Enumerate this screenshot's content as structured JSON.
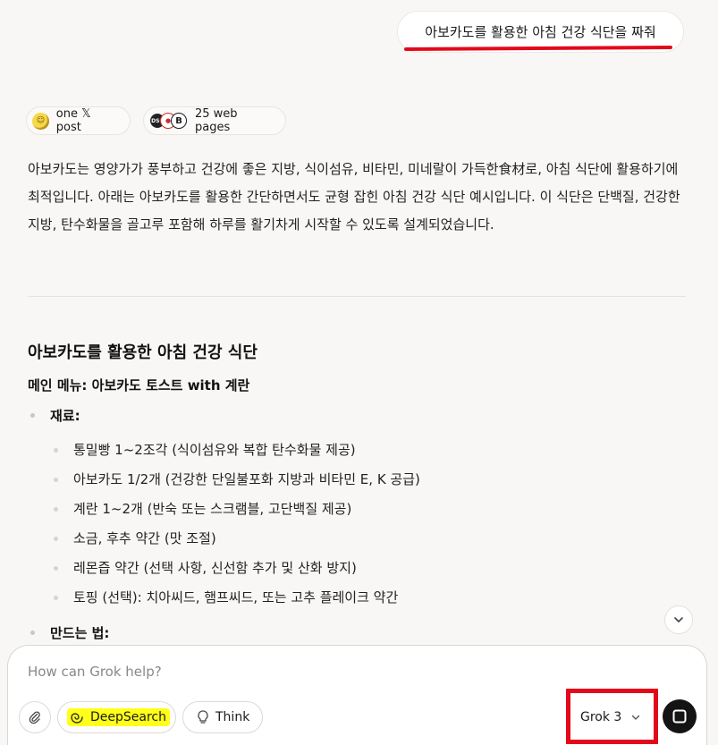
{
  "user_message": "아보카도를 활용한 아침 건강 식단을 짜줘",
  "sources": {
    "x_posts": "one 𝕏 post",
    "web_pages": "25 web pages"
  },
  "response": {
    "intro": "아보카도는 영양가가 풍부하고 건강에 좋은 지방, 식이섬유, 비타민, 미네랄이 가득한食材로, 아침 식단에 활용하기에 최적입니다. 아래는 아보카도를 활용한 간단하면서도 균형 잡힌 아침 건강 식단 예시입니다. 이 식단은 단백질, 건강한 지방, 탄수화물을 골고루 포함해 하루를 활기차게 시작할 수 있도록 설계되었습니다.",
    "heading": "아보카도를 활용한 아침 건강 식단",
    "main_menu": "메인 메뉴: 아보카도 토스트 with 계란",
    "ingredients_label": "재료:",
    "ingredients": [
      "통밀빵 1~2조각 (식이섬유와 복합 탄수화물 제공)",
      "아보카도 1/2개 (건강한 단일불포화 지방과 비타민 E, K 공급)",
      "계란 1~2개 (반숙 또는 스크램블, 고단백질 제공)",
      "소금, 후추 약간 (맛 조절)",
      "레몬즙 약간 (선택 사항, 신선함 추가 및 산화 방지)",
      "토핑 (선택): 치아씨드, 햄프씨드, 또는 고추 플레이크 약간"
    ],
    "method_label": "만드는 법:"
  },
  "composer": {
    "placeholder": "How can Grok help?",
    "deepsearch_label": "DeepSearch",
    "think_label": "Think",
    "model": "Grok 3"
  },
  "colors": {
    "annotation_red": "#e3091a",
    "highlight_yellow": "#ffff1a",
    "background": "#f8f7f5"
  }
}
